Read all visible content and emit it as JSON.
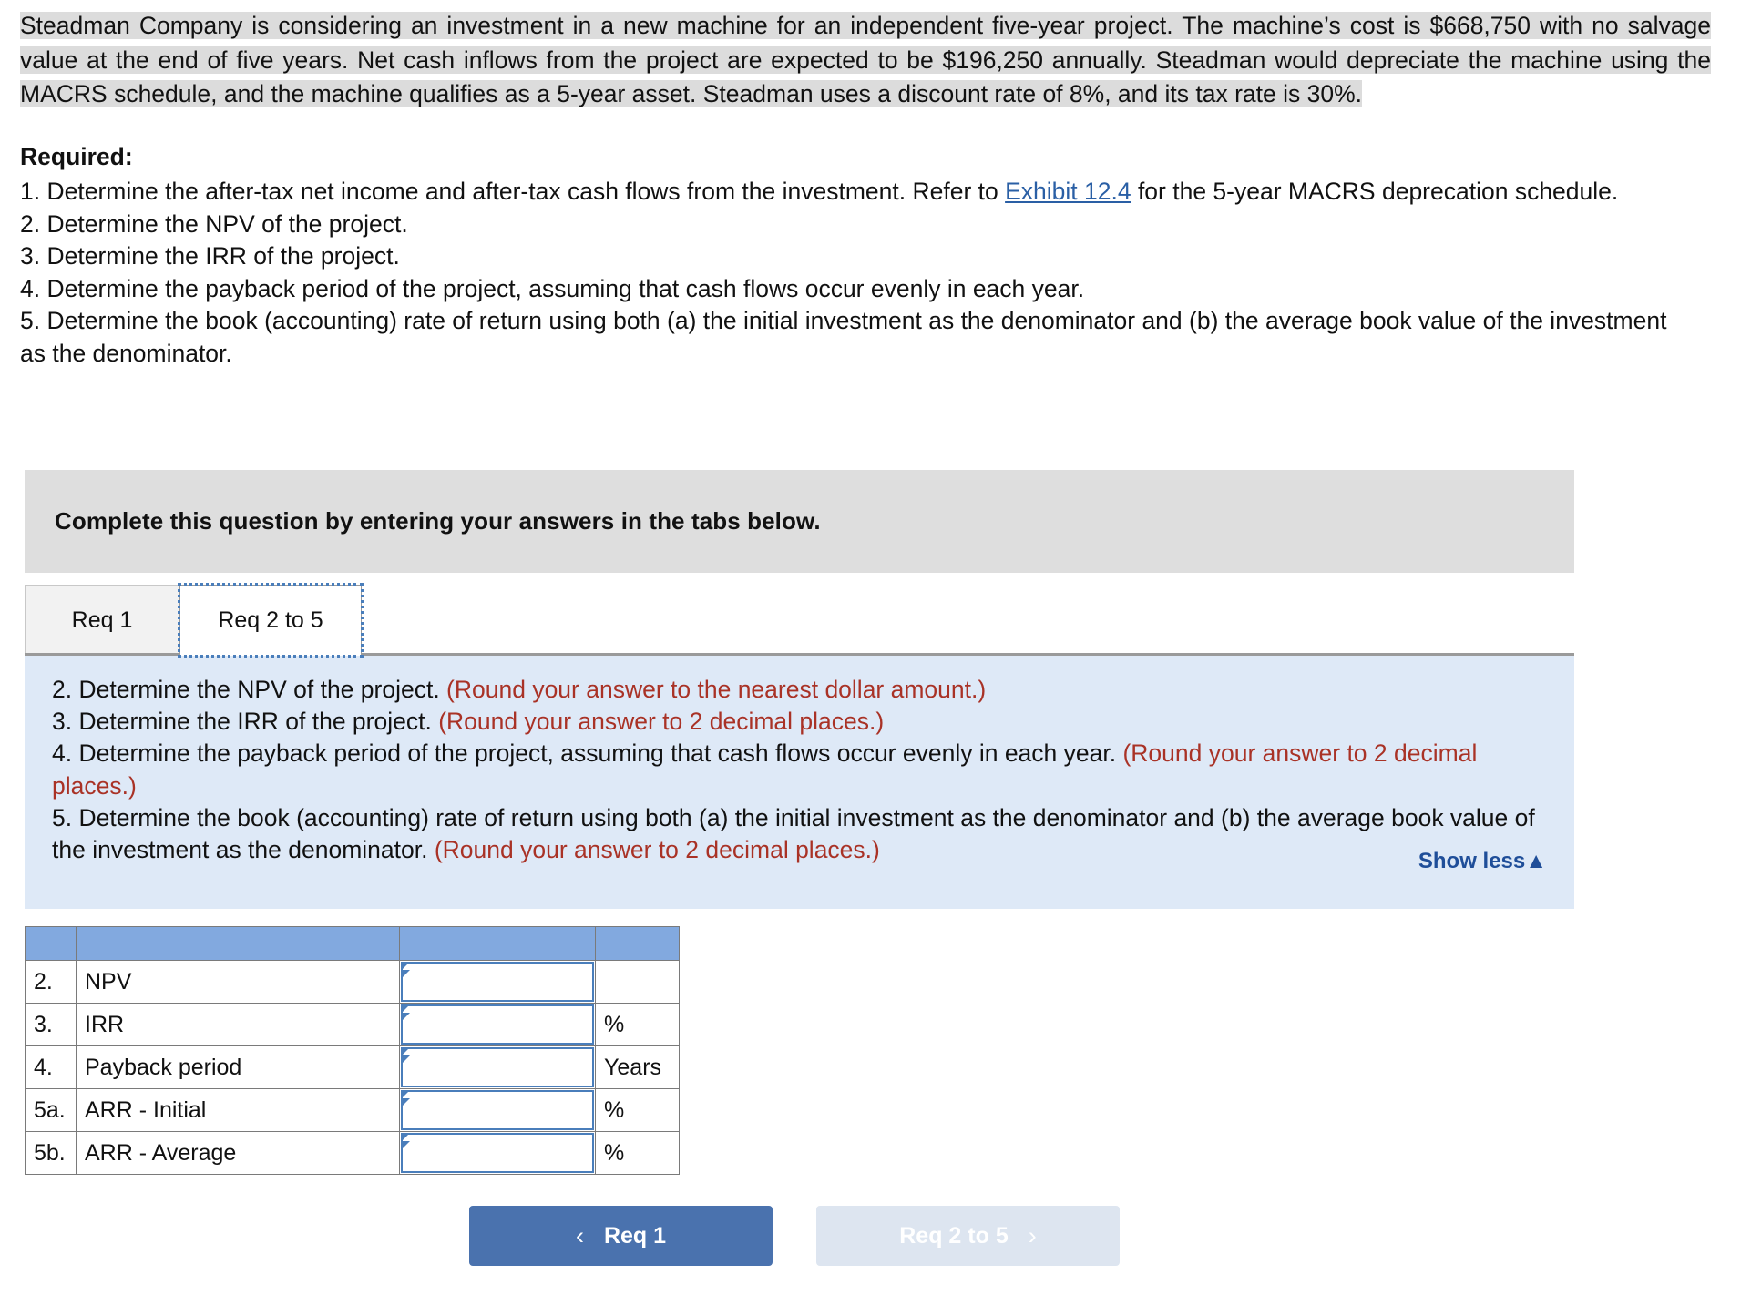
{
  "problem": {
    "text": "Steadman Company is considering an investment in a new machine for an independent five-year project. The machine’s cost is $668,750 with no salvage value at the end of five years. Net cash inflows from the project are expected to be $196,250 annually. Steadman would depreciate the machine using the MACRS schedule, and the machine qualifies as a 5-year asset. Steadman uses a discount rate of 8%, and its tax rate is 30%."
  },
  "required": {
    "heading": "Required:",
    "item1_pre": "1. Determine the after-tax net income and after-tax cash flows from the investment. Refer to ",
    "item1_link": "Exhibit 12.4",
    "item1_post": " for the 5-year MACRS deprecation schedule.",
    "item2": "2. Determine the NPV of the project.",
    "item3": "3. Determine the IRR of the project.",
    "item4": "4. Determine the payback period of the project, assuming that cash flows occur evenly in each year.",
    "item5": "5. Determine the book (accounting) rate of return using both (a) the initial investment as the denominator and (b) the average book value of the investment as the denominator."
  },
  "banner": {
    "text": "Complete this question by entering your answers in the tabs below."
  },
  "tabs": [
    {
      "label": "Req 1",
      "active": false
    },
    {
      "label": "Req 2 to 5",
      "active": true
    }
  ],
  "panel": {
    "line2_main": "2. Determine the NPV of the project. ",
    "line2_note": "(Round your answer to the nearest dollar amount.)",
    "line3_main": "3. Determine the IRR of the project. ",
    "line3_note": "(Round your answer to 2 decimal places.)",
    "line4_main": "4. Determine the payback period of the project, assuming that cash flows occur evenly in each year. ",
    "line4_note": "(Round your answer to 2 decimal places.)",
    "line5_main": "5. Determine the book (accounting) rate of return using both (a) the initial investment as the denominator and (b) the average book value of the investment as the denominator. ",
    "line5_note": "(Round your answer to 2 decimal places.)",
    "show_less": "Show less▲"
  },
  "answer_table": {
    "rows": [
      {
        "num": "2.",
        "label": "NPV",
        "value": "",
        "unit": ""
      },
      {
        "num": "3.",
        "label": "IRR",
        "value": "",
        "unit": "%"
      },
      {
        "num": "4.",
        "label": "Payback period",
        "value": "",
        "unit": "Years"
      },
      {
        "num": "5a.",
        "label": "ARR - Initial",
        "value": "",
        "unit": "%"
      },
      {
        "num": "5b.",
        "label": "ARR - Average",
        "value": "",
        "unit": "%"
      }
    ]
  },
  "nav": {
    "prev_chevron": "‹",
    "prev_label": "Req 1",
    "next_label": "Req 2 to 5",
    "next_chevron": "›"
  },
  "colors": {
    "header_blue": "#82a9df",
    "panel_blue": "#dee9f7",
    "banner_grey": "#dedede",
    "highlight_grey": "#dcdcdc",
    "primary_button": "#4a72ae",
    "disabled_button": "#dde5f0",
    "link_blue": "#2a5fa5",
    "note_red": "#a93226",
    "show_less_blue": "#1f4e99"
  }
}
